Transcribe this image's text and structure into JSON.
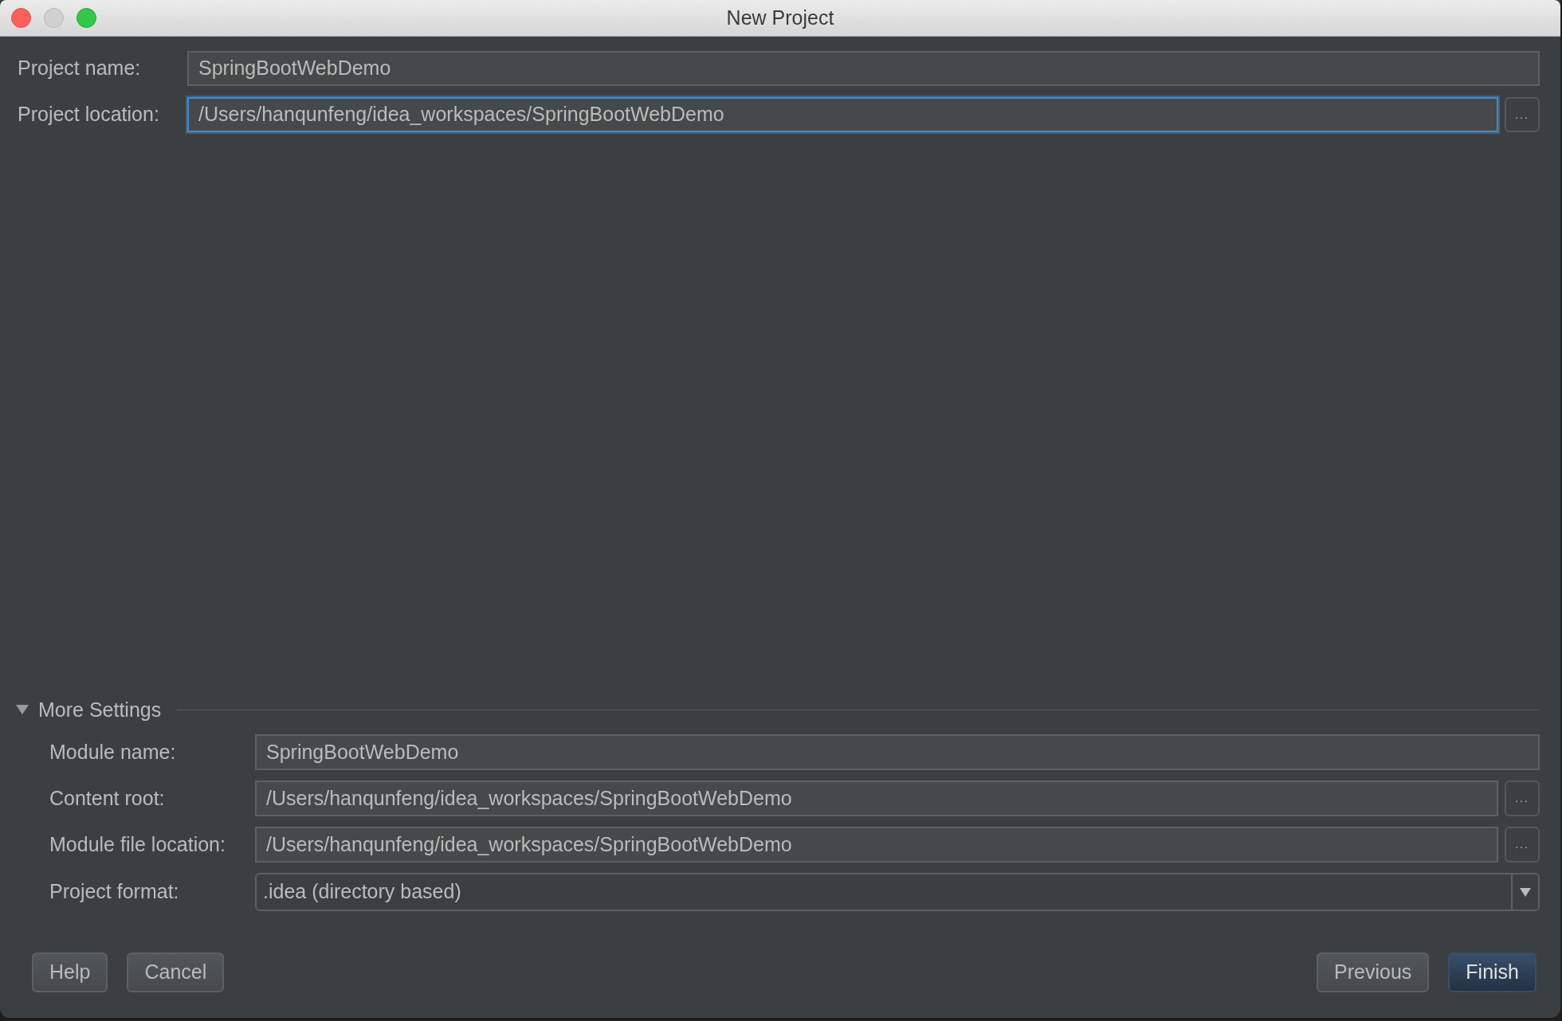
{
  "window": {
    "title": "New Project"
  },
  "fields": [
    {
      "label": "Project name:",
      "value": "SpringBootWebDemo",
      "kind": "text",
      "focused": false
    },
    {
      "label": "Project location:",
      "value": "/Users/hanqunfeng/idea_workspaces/SpringBootWebDemo",
      "kind": "browse",
      "browse_label": "...",
      "focused": true
    }
  ],
  "more_settings": {
    "title": "More Settings",
    "expanded": true,
    "fields": [
      {
        "label": "Module name:",
        "value": "SpringBootWebDemo",
        "kind": "text",
        "focused": false
      },
      {
        "label": "Content root:",
        "value": "/Users/hanqunfeng/idea_workspaces/SpringBootWebDemo",
        "kind": "browse",
        "browse_label": "...",
        "focused": false
      },
      {
        "label": "Module file location:",
        "value": "/Users/hanqunfeng/idea_workspaces/SpringBootWebDemo",
        "kind": "browse",
        "browse_label": "...",
        "focused": false
      },
      {
        "label": "Project format:",
        "value": ".idea (directory based)",
        "kind": "dropdown",
        "focused": false
      }
    ]
  },
  "buttons_left": [
    {
      "label": "Help",
      "default": false
    },
    {
      "label": "Cancel",
      "default": false
    }
  ],
  "buttons_right": [
    {
      "label": "Previous",
      "default": false
    },
    {
      "label": "Finish",
      "default": true
    }
  ]
}
